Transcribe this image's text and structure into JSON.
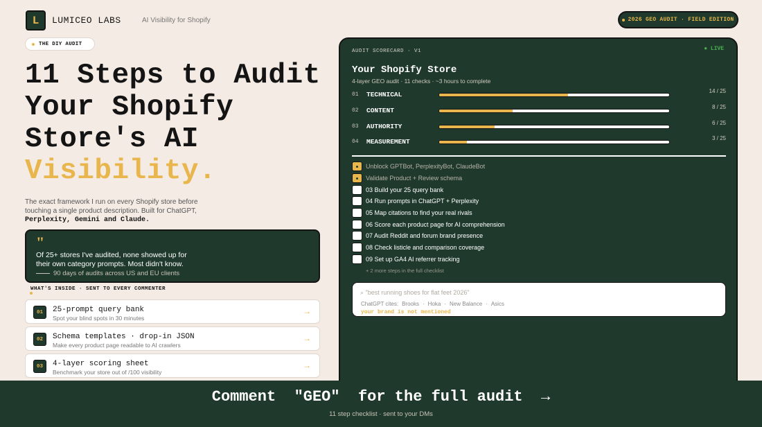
{
  "header": {
    "logo_letter": "L",
    "brand": "LUMICEO LABS",
    "tagline": "AI Visibility for Shopify",
    "edition_badge": "2026 GEO AUDIT · FIELD EDITION"
  },
  "hero": {
    "pill": "THE DIY AUDIT",
    "headline_lines": [
      "11 Steps to Audit",
      "Your Shopify",
      "Store's AI"
    ],
    "headline_accent": "Visibility.",
    "intro": "The exact framework I run on every Shopify store before touching a single product description. Built for ChatGPT,",
    "intro_strong": "Perplexity, Gemini and Claude."
  },
  "quote": {
    "mark": "\"",
    "text": "Of 25+ stores I've audited, none showed up for their own category prompts. Most didn't know.",
    "source": "90 days of audits across US and EU clients"
  },
  "inside": {
    "label": "WHAT'S INSIDE · SENT TO EVERY COMMENTER",
    "items": [
      {
        "num": "01",
        "title": "25-prompt query bank",
        "sub": "Spot your blind spots in 30 minutes",
        "arrow": "→"
      },
      {
        "num": "02",
        "title": "Schema templates · drop-in JSON",
        "sub": "Make every product page readable to AI crawlers",
        "arrow": "→"
      },
      {
        "num": "03",
        "title": "4-layer scoring sheet",
        "sub": "Benchmark your store out of /100 visibility",
        "arrow": "→"
      }
    ]
  },
  "scorecard": {
    "label": "AUDIT SCORECARD · V1",
    "live": "● LIVE",
    "title": "Your Shopify Store",
    "subtitle": "4-layer GEO audit · 11 checks · ~3 hours to complete",
    "layers": [
      {
        "num": "01",
        "name": "TECHNICAL",
        "score": "14 / 25",
        "fraction": 0.56
      },
      {
        "num": "02",
        "name": "CONTENT",
        "score": "8 / 25",
        "fraction": 0.32
      },
      {
        "num": "03",
        "name": "AUTHORITY",
        "score": "6 / 25",
        "fraction": 0.24
      },
      {
        "num": "04",
        "name": "MEASUREMENT",
        "score": "3 / 25",
        "fraction": 0.12
      }
    ],
    "steps": [
      {
        "text": "Unblock GPTBot, PerplexityBot, ClaudeBot",
        "done": true
      },
      {
        "text": "Validate Product + Review schema",
        "done": true
      },
      {
        "text": "03  Build your 25 query bank",
        "done": false
      },
      {
        "text": "04  Run prompts in ChatGPT + Perplexity",
        "done": false
      },
      {
        "text": "05  Map citations to find your real rivals",
        "done": false
      },
      {
        "text": "06  Score each product page for AI comprehension",
        "done": false
      },
      {
        "text": "07  Audit Reddit and forum brand presence",
        "done": false
      },
      {
        "text": "08  Check listicle and comparison coverage",
        "done": false
      },
      {
        "text": "09  Set up GA4 AI referrer tracking",
        "done": false
      }
    ],
    "more": "+ 2 more steps in the full checklist",
    "search": {
      "query": "⌕ \"best running shoes for flat feet 2026\"",
      "cites_label": "ChatGPT cites:",
      "cites": [
        "Brooks",
        "·",
        "Hoka",
        "·",
        "New Balance",
        "·",
        "Asics"
      ],
      "warning": "your brand is not mentioned"
    }
  },
  "footer": {
    "cta": "Comment  \"GEO\"  for the full audit  →",
    "sub": "11 step checklist · sent to your DMs"
  },
  "colors": {
    "accent": "#e8b64c",
    "dark_green": "#1f3a2c",
    "background": "#f4ebe4",
    "live_green": "#4caf50"
  }
}
